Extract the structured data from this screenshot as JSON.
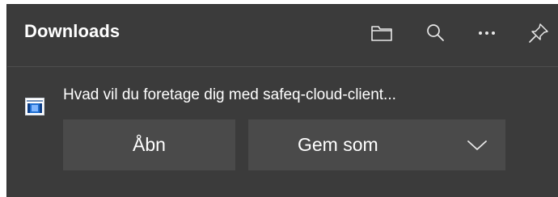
{
  "panel": {
    "title": "Downloads",
    "header_icons": [
      "folder-icon",
      "search-icon",
      "more-icon",
      "pin-icon"
    ]
  },
  "download": {
    "icon": "installer-file-icon",
    "prompt": "Hvad vil du foretage dig med safeq-cloud-client...",
    "open_label": "Åbn",
    "save_label": "Gem som",
    "save_options_icon": "chevron-down-icon"
  },
  "colors": {
    "panel_bg": "#3b3b3b",
    "button_bg": "#4a4a4a",
    "text": "#ffffff",
    "file_icon_blue": "#1f6fd1"
  }
}
